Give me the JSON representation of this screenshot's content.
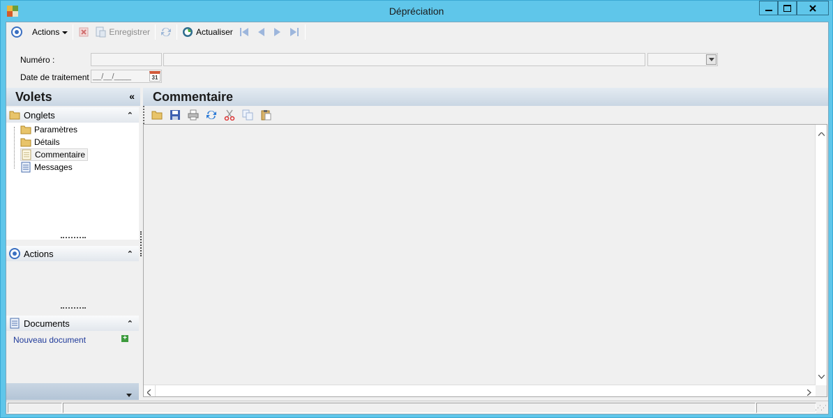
{
  "window": {
    "title": "Dépréciation"
  },
  "toolbar": {
    "actions_label": "Actions",
    "save_label": "Enregistrer",
    "refresh_label": "Actualiser"
  },
  "form": {
    "numero_label": "Numéro :",
    "numero_value": "",
    "date_label": "Date de traitement :",
    "date_value": "__/__/____",
    "calendar_day": "31"
  },
  "left_panel": {
    "title": "Volets",
    "onglets": {
      "title": "Onglets",
      "items": [
        {
          "label": "Paramètres",
          "icon": "folder-icon"
        },
        {
          "label": "Détails",
          "icon": "folder-icon"
        },
        {
          "label": "Commentaire",
          "icon": "document-icon",
          "selected": true
        },
        {
          "label": "Messages",
          "icon": "document-icon"
        }
      ]
    },
    "actions": {
      "title": "Actions"
    },
    "documents": {
      "title": "Documents",
      "new_document": "Nouveau document"
    }
  },
  "main": {
    "title": "Commentaire"
  },
  "colors": {
    "titlebar": "#5fc6ea",
    "header_text": "#1a1a1a",
    "link": "#1f3a9a"
  }
}
